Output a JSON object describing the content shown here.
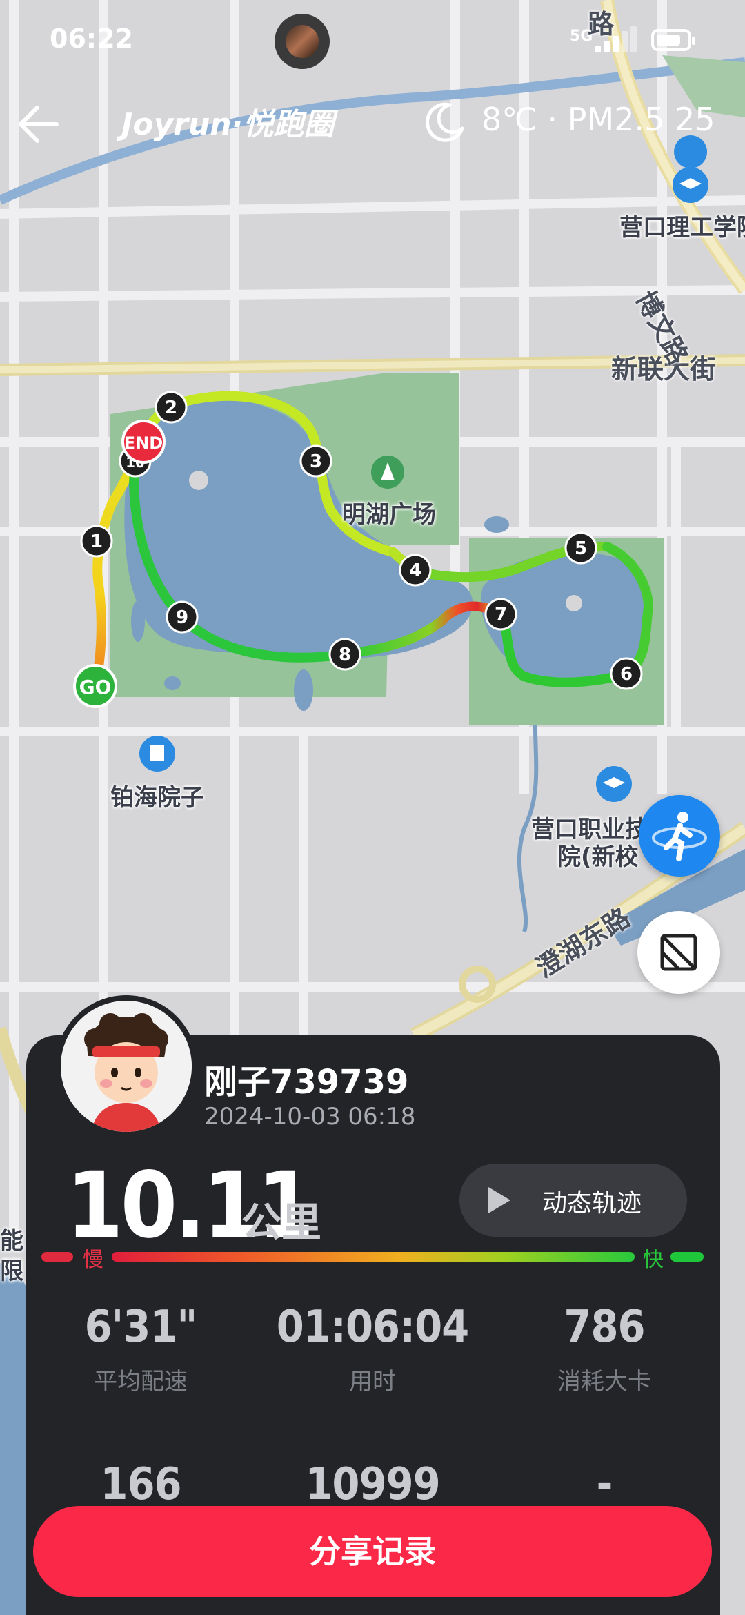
{
  "status_bar": {
    "time": "06:22",
    "network": "5G",
    "battery_percent": 80
  },
  "header": {
    "brand": "Joyrun·悦跑圈",
    "weather": "8℃ · PM2.5 25",
    "back_icon": "arrow-left-icon",
    "weather_icon": "crescent-moon-icon"
  },
  "map": {
    "labels": {
      "mingling_plaza": "明湖广场",
      "bohai_yard": "铂海院子",
      "yingkou_tech": "营口理工学院",
      "yingkou_vocational_1": "营口职业技",
      "yingkou_vocational_2": "院(新校",
      "xinlian_street": "新联大街",
      "bowen_road": "博文路",
      "chenghu_east_road": "澄湖东路",
      "top_road_fragment": "路",
      "left_fragment_1": "能",
      "left_fragment_2": "限"
    },
    "route_markers": [
      "1",
      "2",
      "3",
      "4",
      "5",
      "6",
      "7",
      "8",
      "9",
      "10"
    ],
    "start_label": "GO",
    "end_label": "END"
  },
  "runner": {
    "name": "刚子739739",
    "datetime": "2024-10-03 06:18",
    "distance": "10.11",
    "distance_unit": "公里"
  },
  "track_button": {
    "label": "动态轨迹"
  },
  "pace_scale": {
    "slow": "慢",
    "fast": "快"
  },
  "stats": [
    {
      "value": "6'31\"",
      "label": "平均配速"
    },
    {
      "value": "01:06:04",
      "label": "用时"
    },
    {
      "value": "786",
      "label": "消耗大卡"
    },
    {
      "value": "166",
      "label": ""
    },
    {
      "value": "10999",
      "label": ""
    },
    {
      "value": "-",
      "label": ""
    }
  ],
  "share_button": {
    "label": "分享记录"
  },
  "colors": {
    "card_bg": "#232428",
    "share_red": "#fb2848",
    "route_fast": "#28c83c",
    "route_slow": "#e01e3c",
    "map_water": "#7b9fc3",
    "map_park": "#97c39a",
    "runner_button": "#1e88f0"
  }
}
